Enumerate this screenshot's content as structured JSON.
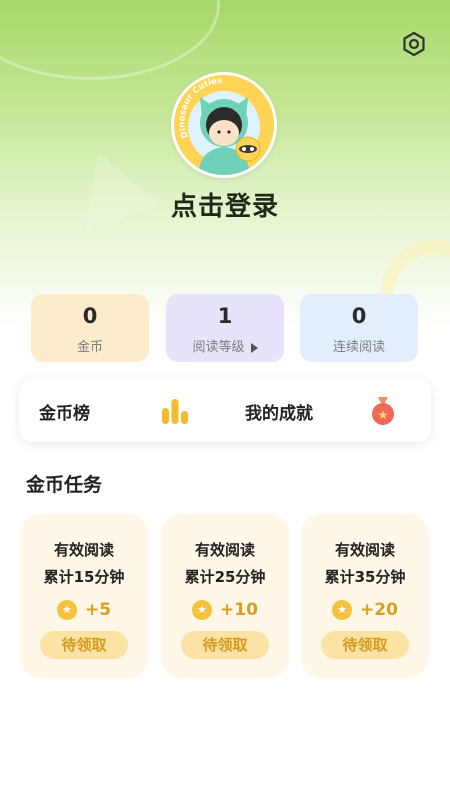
{
  "profile": {
    "avatar_text": "Dinosaur Cuties",
    "login_label": "点击登录"
  },
  "stats": [
    {
      "value": "0",
      "label": "金币"
    },
    {
      "value": "1",
      "label": "阅读等级"
    },
    {
      "value": "0",
      "label": "连续阅读"
    }
  ],
  "entries": {
    "coin_rank": "金币榜",
    "achievements": "我的成就"
  },
  "tasks_section": {
    "title": "金币任务",
    "tasks": [
      {
        "line1": "有效阅读",
        "line2": "累计15分钟",
        "reward": "+5",
        "button": "待领取"
      },
      {
        "line1": "有效阅读",
        "line2": "累计25分钟",
        "reward": "+10",
        "button": "待领取"
      },
      {
        "line1": "有效阅读",
        "line2": "累计35分钟",
        "reward": "+20",
        "button": "待领取"
      }
    ]
  },
  "icons": {
    "settings": "gear-icon",
    "coin_rank": "bar-chart-icon",
    "achievements": "medal-icon",
    "coin": "coin-icon",
    "level_arrow": "play-icon"
  },
  "colors": {
    "hero_top": "#a6d86a",
    "coin_bg": "#fdeccc",
    "level_bg": "#e8e2fa",
    "streak_bg": "#e2eefc",
    "task_bg": "#fff7e8",
    "task_button_bg": "#fde2a6",
    "accent_gold": "#d8a020"
  }
}
